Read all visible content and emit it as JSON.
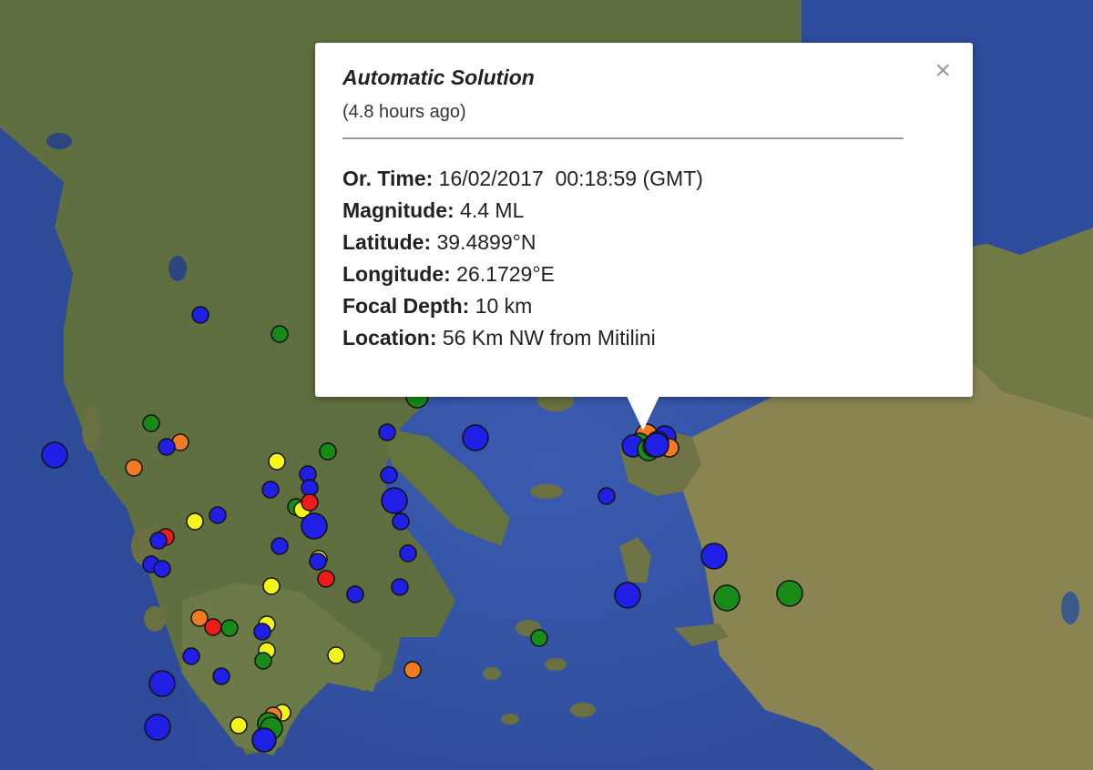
{
  "popup": {
    "title": "Automatic Solution",
    "subtitle": "(4.8 hours ago)",
    "close_label": "×",
    "rows": [
      {
        "key": "Or. Time:",
        "value": " 16/02/2017  00:18:59 (GMT)"
      },
      {
        "key": "Magnitude:",
        "value": " 4.4 ML"
      },
      {
        "key": "Latitude:",
        "value": " 39.4899°N"
      },
      {
        "key": "Longitude:",
        "value": " 26.1729°E"
      },
      {
        "key": "Focal Depth:",
        "value": " 10 km"
      },
      {
        "key": "Location:",
        "value": " 56 Km NW from Mitilini"
      }
    ]
  },
  "colors": {
    "sea": "#2f4fa0",
    "land": "#5d6e3e",
    "blue": "#1f1fe6",
    "green": "#178a17",
    "yellow": "#f5f51c",
    "orange": "#f27a21",
    "red": "#ee1b1b"
  }
}
